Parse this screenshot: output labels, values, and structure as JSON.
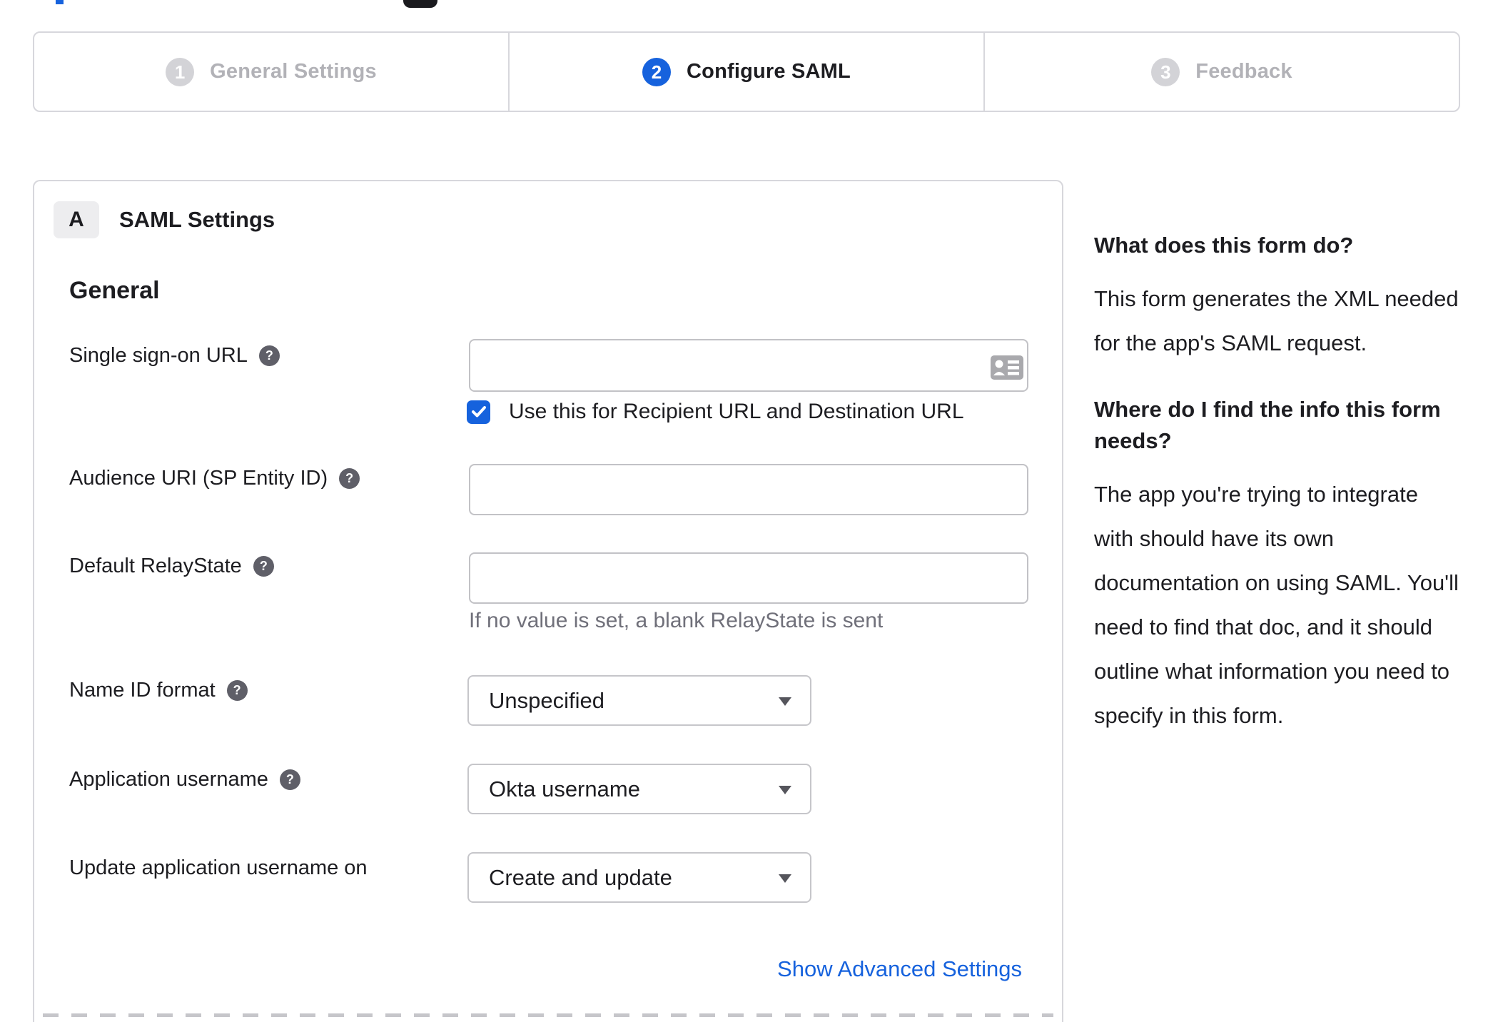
{
  "stepper": {
    "steps": [
      {
        "number": "1",
        "label": "General Settings",
        "state": "inactive"
      },
      {
        "number": "2",
        "label": "Configure SAML",
        "state": "active"
      },
      {
        "number": "3",
        "label": "Feedback",
        "state": "inactive"
      }
    ]
  },
  "panel": {
    "badge": "A",
    "title": "SAML Settings",
    "section": "General",
    "sso": {
      "label": "Single sign-on URL",
      "value": "",
      "checkbox_label": "Use this for Recipient URL and Destination URL",
      "checkbox_checked": true
    },
    "audience": {
      "label": "Audience URI (SP Entity ID)",
      "value": ""
    },
    "relay": {
      "label": "Default RelayState",
      "value": "",
      "hint": "If no value is set, a blank RelayState is sent"
    },
    "nameid": {
      "label": "Name ID format",
      "value": "Unspecified"
    },
    "appuser": {
      "label": "Application username",
      "value": "Okta username"
    },
    "updateuser": {
      "label": "Update application username on",
      "value": "Create and update"
    },
    "advanced_link": "Show Advanced Settings"
  },
  "sidebar": {
    "q1": "What does this form do?",
    "a1": "This form generates the XML needed for the app's SAML request.",
    "q2": "Where do I find the info this form needs?",
    "a2": "The app you're trying to integrate with should have its own documentation on using SAML. You'll need to find that doc, and it should outline what information you need to specify in this form."
  },
  "colors": {
    "accent_blue": "#1662dd",
    "inactive_step_gray": "#d3d3d7",
    "border_gray": "#d7d7dc",
    "hint_gray": "#70707a"
  }
}
